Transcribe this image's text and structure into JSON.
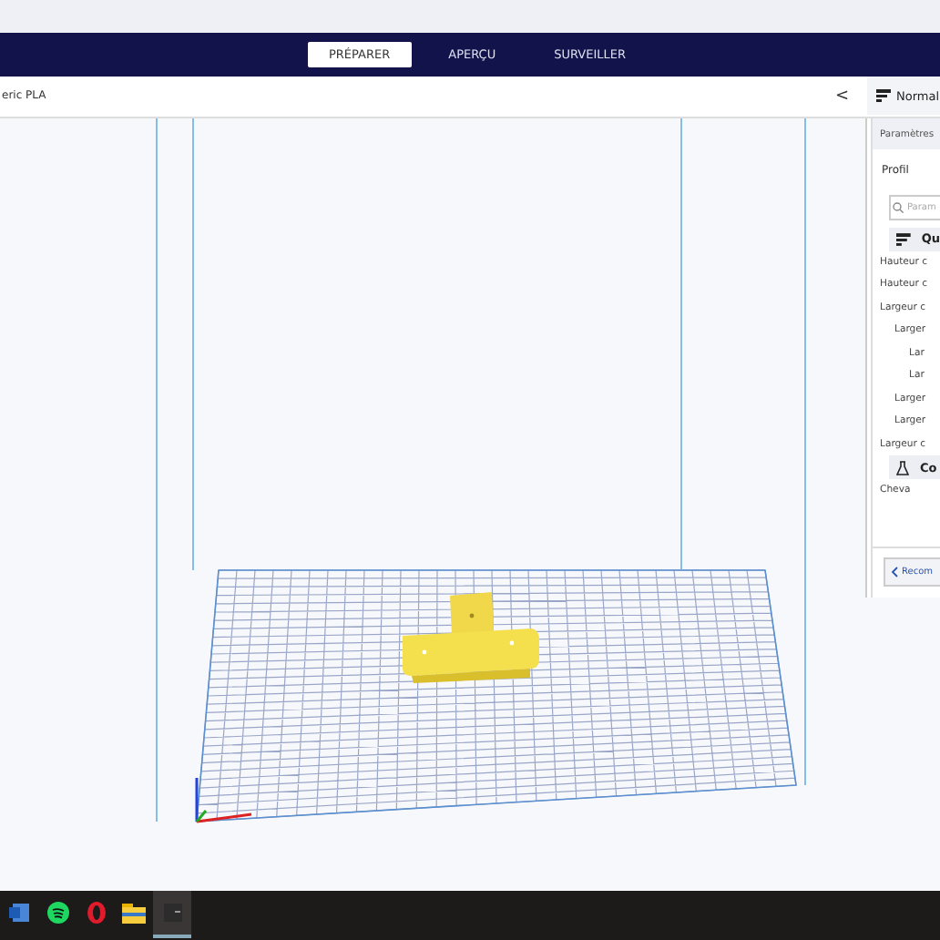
{
  "tabs": [
    {
      "label": "PRÉPARER",
      "selected": true
    },
    {
      "label": "APERÇU",
      "selected": false
    },
    {
      "label": "SURVEILLER",
      "selected": false
    }
  ],
  "material": "eric PLA",
  "collapse_button": "<",
  "profile_panel": {
    "title": "Normal",
    "section_tab": "Paramètres",
    "profile_label": "Profil",
    "search_placeholder": "Param",
    "settings": [
      {
        "kind": "quality",
        "label": "Qu"
      },
      {
        "kind": "setting",
        "label": "Hauteur c"
      },
      {
        "kind": "setting",
        "label": "Hauteur c"
      },
      {
        "kind": "setting",
        "label": "Largeur c",
        "children": [
          {
            "kind": "setting",
            "label": "Larger",
            "children": [
              {
                "kind": "setting",
                "label": "Lar"
              },
              {
                "kind": "setting",
                "label": "Lar"
              }
            ]
          },
          {
            "kind": "setting",
            "label": "Larger"
          },
          {
            "kind": "setting",
            "label": "Larger"
          }
        ]
      },
      {
        "kind": "setting",
        "label": "Largeur c"
      },
      {
        "kind": "material",
        "label": "Co"
      },
      {
        "kind": "setting",
        "label": "Cheva"
      }
    ],
    "recommended_button": "Recom"
  },
  "taskbar": [
    {
      "kind": "word",
      "active": false
    },
    {
      "kind": "spotify",
      "active": false
    },
    {
      "kind": "opera",
      "active": false
    },
    {
      "kind": "folder",
      "active": false
    },
    {
      "kind": "app",
      "active": true
    }
  ]
}
